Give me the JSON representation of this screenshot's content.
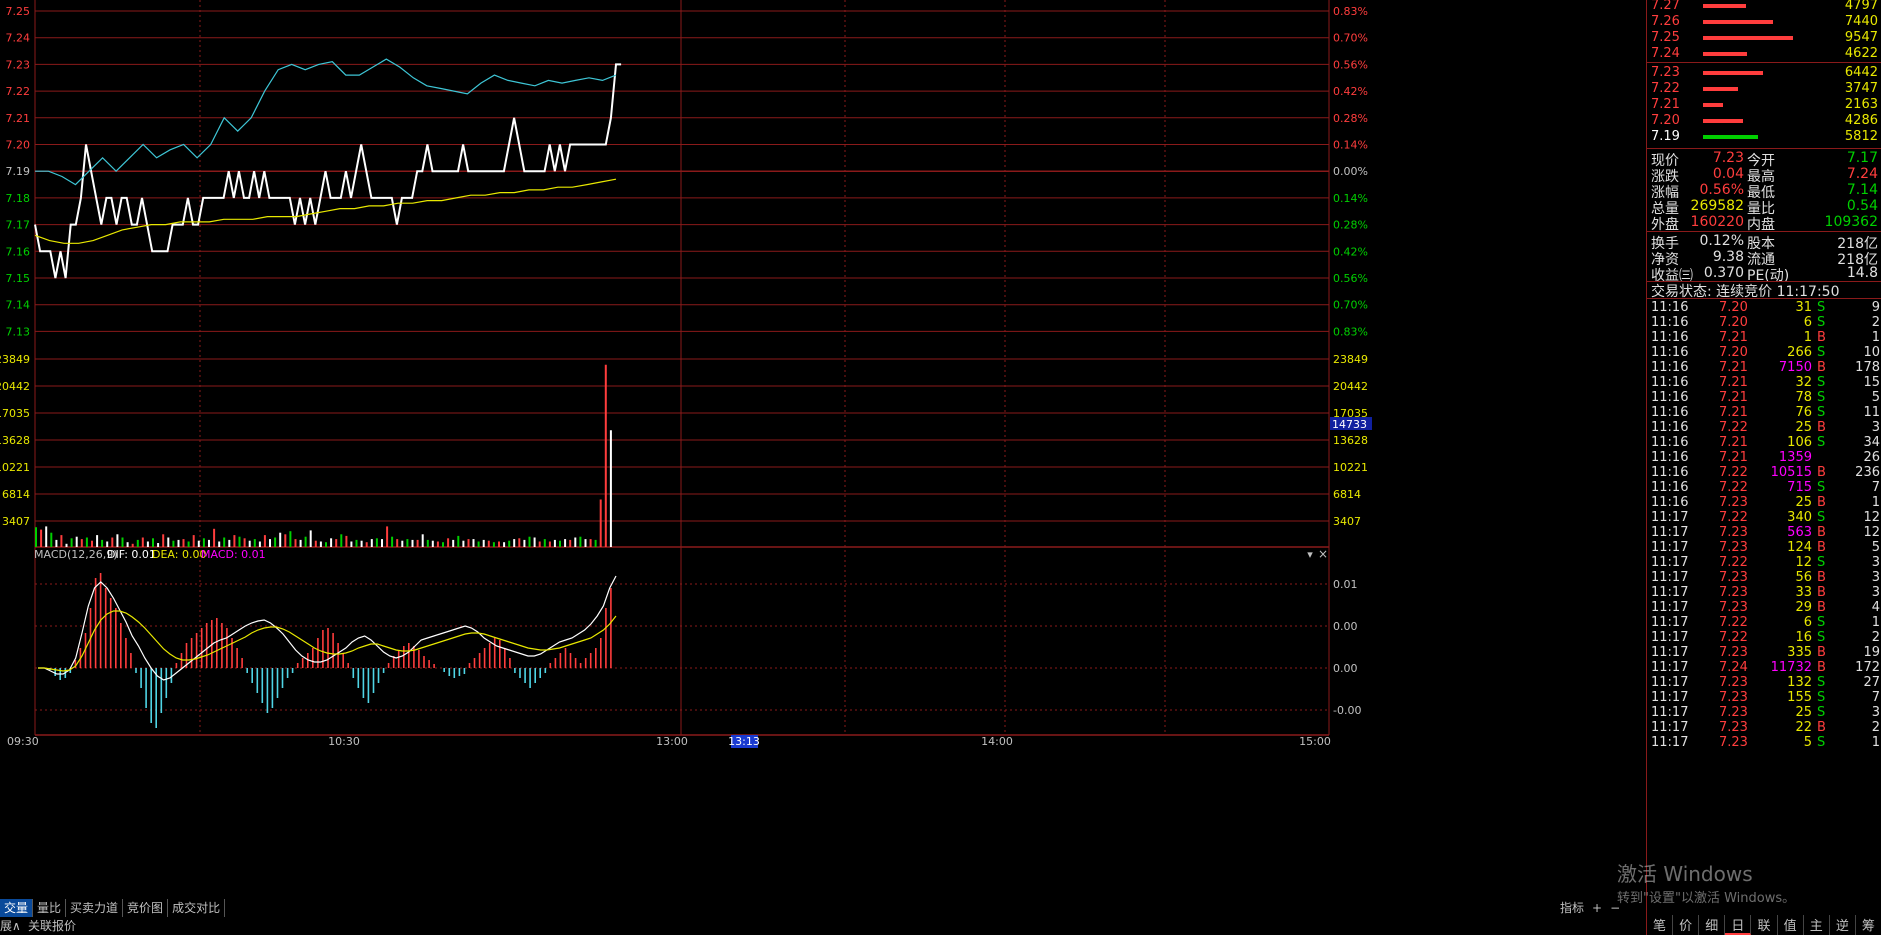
{
  "price_axis": {
    "left": [
      "7.25",
      "7.24",
      "7.23",
      "7.22",
      "7.21",
      "7.20",
      "7.19",
      "7.18",
      "7.17",
      "7.16",
      "7.15",
      "7.14",
      "7.13"
    ],
    "right": [
      "0.83%",
      "0.70%",
      "0.56%",
      "0.42%",
      "0.28%",
      "0.14%",
      "0.00%",
      "0.14%",
      "0.28%",
      "0.42%",
      "0.56%",
      "0.70%",
      "0.83%"
    ]
  },
  "volume_axis": {
    "left": [
      "23849",
      "20442",
      "17035",
      "13628",
      "10221",
      "6814",
      "3407"
    ],
    "right": [
      "23849",
      "20442",
      "17035",
      "13628",
      "10221",
      "6814",
      "3407"
    ],
    "highlight": "14733"
  },
  "macd": {
    "label": "MACD(12,26,9)",
    "dif_label": "DIF: 0.01",
    "dea_label": "DEA: 0.00",
    "macd_label": "MACD: 0.01",
    "axis": [
      "0.01",
      "0.00",
      "0.00",
      "-0.00"
    ]
  },
  "time_axis": {
    "t0930": "09:30",
    "t1030": "10:30",
    "t1300": "13:00",
    "t1313": "13:13",
    "t1400": "14:00",
    "t1500": "15:00"
  },
  "bottom_tabs": [
    "交量",
    "量比",
    "买卖力道",
    "竞价图",
    "成交对比"
  ],
  "bottom_right": {
    "indicator": "指标",
    "plus": "+",
    "minus": "−"
  },
  "status_row": {
    "left1": "展∧",
    "left2": "关联报价"
  },
  "sell_orders": [
    {
      "price": "7.27",
      "vol": "4797"
    },
    {
      "price": "7.26",
      "vol": "7440"
    },
    {
      "price": "7.25",
      "vol": "9547"
    },
    {
      "price": "7.24",
      "vol": "4622"
    }
  ],
  "buy_orders": [
    {
      "price": "7.23",
      "vol": "6442"
    },
    {
      "price": "7.22",
      "vol": "3747"
    },
    {
      "price": "7.21",
      "vol": "2163"
    },
    {
      "price": "7.20",
      "vol": "4286"
    },
    {
      "price": "7.19",
      "vol": "5812"
    }
  ],
  "quote": {
    "xianjia_l": "现价",
    "xianjia_v": "7.23",
    "jinkai_l": "今开",
    "jinkai_v": "7.17",
    "zhangdie_l": "涨跌",
    "zhangdie_v": "0.04",
    "zuigao_l": "最高",
    "zuigao_v": "7.24",
    "zhangfu_l": "涨幅",
    "zhangfu_v": "0.56%",
    "zuidi_l": "最低",
    "zuidi_v": "7.14",
    "zongliang_l": "总量",
    "zongliang_v": "269582",
    "liangbi_l": "量比",
    "liangbi_v": "0.54",
    "waipan_l": "外盘",
    "waipan_v": "160220",
    "neipan_l": "内盘",
    "neipan_v": "109362",
    "huanshou_l": "换手",
    "huanshou_v": "0.12%",
    "guben_l": "股本",
    "guben_v": "218亿",
    "jingzi_l": "净资",
    "jingzi_v": "9.38",
    "liutong_l": "流通",
    "liutong_v": "218亿",
    "shouyi_l": "收益㈢",
    "shouyi_v": "0.370",
    "pe_l": "PE(动)",
    "pe_v": "14.8"
  },
  "trade_status": "交易状态: 连续竞价 11:17:50",
  "trades": [
    [
      "11:16",
      "7.20",
      "31",
      "S",
      "9"
    ],
    [
      "11:16",
      "7.20",
      "6",
      "S",
      "2"
    ],
    [
      "11:16",
      "7.21",
      "1",
      "B",
      "1"
    ],
    [
      "11:16",
      "7.20",
      "266",
      "S",
      "10"
    ],
    [
      "11:16",
      "7.21",
      "7150",
      "B",
      "178"
    ],
    [
      "11:16",
      "7.21",
      "32",
      "S",
      "15"
    ],
    [
      "11:16",
      "7.21",
      "78",
      "S",
      "5"
    ],
    [
      "11:16",
      "7.21",
      "76",
      "S",
      "11"
    ],
    [
      "11:16",
      "7.22",
      "25",
      "B",
      "3"
    ],
    [
      "11:16",
      "7.21",
      "106",
      "S",
      "34"
    ],
    [
      "11:16",
      "7.21",
      "1359",
      "",
      "26"
    ],
    [
      "11:16",
      "7.22",
      "10515",
      "B",
      "236"
    ],
    [
      "11:16",
      "7.22",
      "715",
      "S",
      "7"
    ],
    [
      "11:16",
      "7.23",
      "25",
      "B",
      "1"
    ],
    [
      "11:17",
      "7.22",
      "340",
      "S",
      "12"
    ],
    [
      "11:17",
      "7.23",
      "563",
      "B",
      "12"
    ],
    [
      "11:17",
      "7.23",
      "124",
      "B",
      "5"
    ],
    [
      "11:17",
      "7.22",
      "12",
      "S",
      "3"
    ],
    [
      "11:17",
      "7.23",
      "56",
      "B",
      "3"
    ],
    [
      "11:17",
      "7.23",
      "33",
      "B",
      "3"
    ],
    [
      "11:17",
      "7.23",
      "29",
      "B",
      "4"
    ],
    [
      "11:17",
      "7.22",
      "6",
      "S",
      "1"
    ],
    [
      "11:17",
      "7.22",
      "16",
      "S",
      "2"
    ],
    [
      "11:17",
      "7.23",
      "335",
      "B",
      "19"
    ],
    [
      "11:17",
      "7.24",
      "11732",
      "B",
      "172"
    ],
    [
      "11:17",
      "7.23",
      "132",
      "S",
      "27"
    ],
    [
      "11:17",
      "7.23",
      "155",
      "S",
      "7"
    ],
    [
      "11:17",
      "7.23",
      "25",
      "S",
      "3"
    ],
    [
      "11:17",
      "7.23",
      "22",
      "B",
      "2"
    ],
    [
      "11:17",
      "7.23",
      "5",
      "S",
      "1"
    ]
  ],
  "sidebar_tabs": [
    "笔",
    "价",
    "细",
    "日",
    "联",
    "值",
    "主",
    "逆",
    "筹"
  ],
  "windows_watermark": {
    "line1": "激活 Windows",
    "line2": "转到\"设置\"以激活 Windows。"
  },
  "colors": {
    "up": "#ff3d3d",
    "down": "#00d000",
    "grid": "#8a1a1a",
    "price_line": "#ffffff",
    "avg_line": "#e8e800",
    "ref_line": "#3ec6d6",
    "vol_big": "#ff00ff"
  }
}
